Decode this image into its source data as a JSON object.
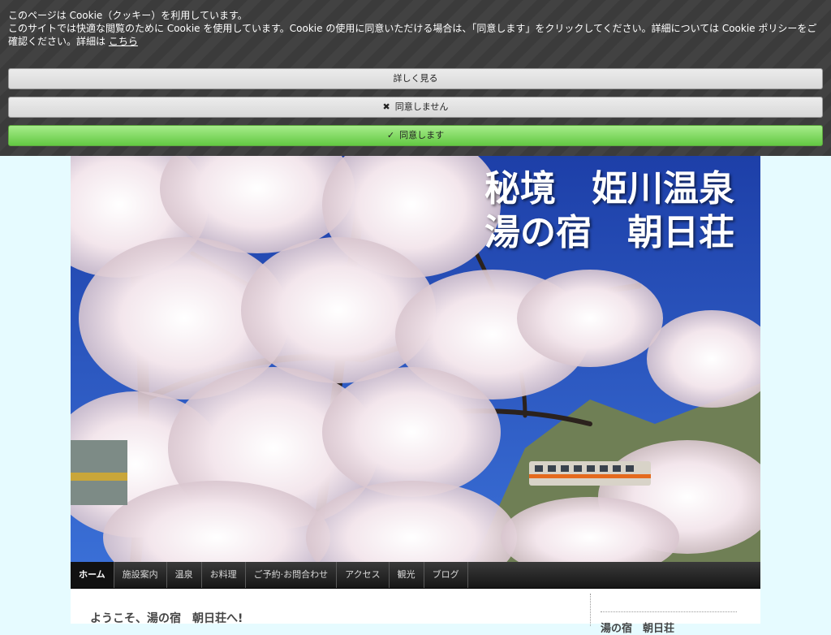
{
  "cookie": {
    "line1": "このページは Cookie（クッキー）を利用しています。",
    "line2": "このサイトでは快適な閲覧のために Cookie を使用しています。Cookie の使用に同意いただける場合は、「同意します」をクリックしてください。詳細については Cookie ポリシーをご確認ください。詳細は",
    "link": "こちら",
    "more_label": "詳しく見る",
    "decline_label": "同意しません",
    "accept_label": "同意します"
  },
  "site": {
    "title": "秘境　姫川温泉\n湯の宿　朝日荘"
  },
  "nav": {
    "items": [
      {
        "label": "ホーム"
      },
      {
        "label": "施設案内"
      },
      {
        "label": "温泉"
      },
      {
        "label": "お料理"
      },
      {
        "label": "ご予約·お問合わせ"
      },
      {
        "label": "アクセス"
      },
      {
        "label": "観光"
      },
      {
        "label": "ブログ"
      }
    ]
  },
  "main": {
    "heading": "ようこそ、湯の宿　朝日荘へ!",
    "sidebar_heading": "湯の宿　朝日荘"
  },
  "colors": {
    "banner_bg": "#3b3b3b",
    "accept_green": "#63c943",
    "page_bg": "#e6fbff",
    "nav_bg": "#161616",
    "sky": "#2550b8"
  },
  "icons": {
    "decline": "close-icon",
    "accept": "check-icon"
  }
}
